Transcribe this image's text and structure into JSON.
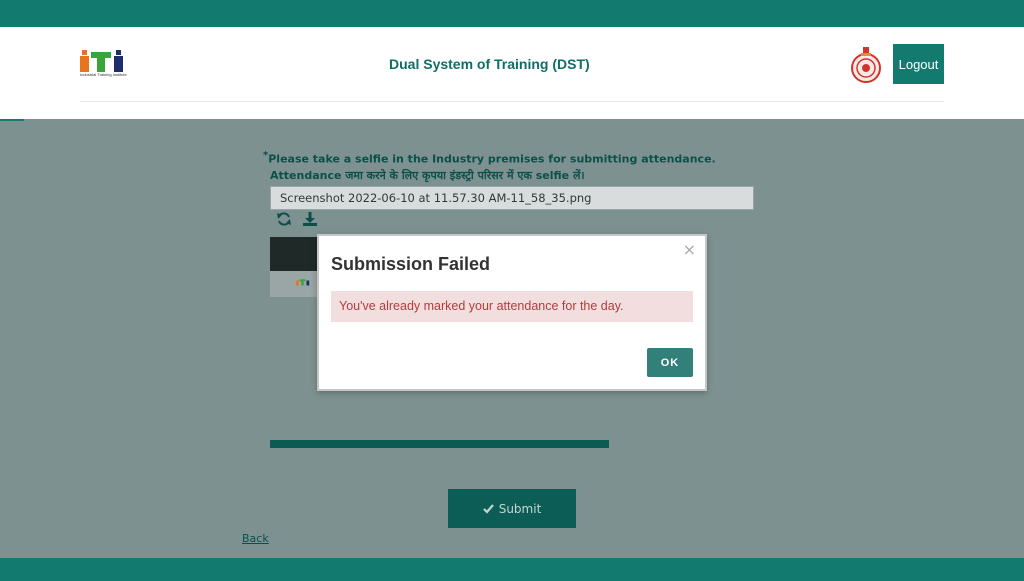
{
  "header": {
    "app_title": "Dual System of Training (DST)",
    "logo_caption": "Industrial Training Institute",
    "logout_label": "Logout",
    "emblem_icon": "haryana-emblem-icon"
  },
  "form": {
    "instruction_marker": "*",
    "instruction_en": "Please take a selfie in the Industry premises for submitting attendance.",
    "instruction_hi": "Attendance जमा करने के लिए कृपया इंडस्ट्री परिसर में एक selfie लें।",
    "file_name": "Screenshot 2022-06-10 at 11.57.30 AM-11_58_35.png",
    "icons": [
      "refresh-icon",
      "download-icon"
    ],
    "submit_label": "Submit",
    "submit_icon": "check-icon",
    "back_label": "Back"
  },
  "modal": {
    "title": "Submission Failed",
    "close_symbol": "×",
    "message": "You've already marked your attendance for the day.",
    "ok_label": "OK"
  },
  "colors": {
    "brand_teal": "#137a70",
    "alert_bg": "#f2dede",
    "alert_text": "#b33d3b"
  }
}
